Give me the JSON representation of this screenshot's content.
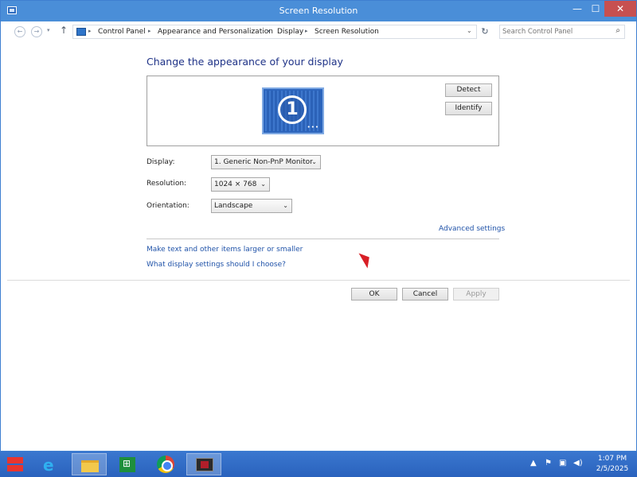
{
  "window": {
    "title": "Screen Resolution",
    "controls": {
      "minimize": "—",
      "maximize": "☐",
      "close": "✕"
    }
  },
  "navigation": {
    "back": "←",
    "forward": "→",
    "recent": "▾",
    "up": "↑",
    "breadcrumbs": [
      "Control Panel",
      "Appearance and Personalization",
      "Display",
      "Screen Resolution"
    ],
    "separator": "▸",
    "dropdown": "⌄",
    "refresh": "↻",
    "search_placeholder": "Search Control Panel",
    "search_icon": "⌕"
  },
  "main": {
    "heading": "Change the appearance of your display",
    "monitor": {
      "number": "1",
      "dots": "•••"
    },
    "detect_label": "Detect",
    "identify_label": "Identify",
    "display_label": "Display:",
    "display_value": "1. Generic Non-PnP Monitor",
    "resolution_label": "Resolution:",
    "resolution_value": "1024 × 768",
    "orientation_label": "Orientation:",
    "orientation_value": "Landscape",
    "select_arrow": "⌄",
    "advanced_link": "Advanced settings",
    "text_size_link": "Make text and other items larger or smaller",
    "help_link": "What display settings should I choose?"
  },
  "dialog_buttons": {
    "ok": "OK",
    "cancel": "Cancel",
    "apply": "Apply",
    "apply_enabled": false
  },
  "taskbar": {
    "apps": [
      "start",
      "internet-explorer",
      "file-explorer",
      "store",
      "chrome",
      "screen-resolution"
    ],
    "tray_icons": {
      "show_hidden": "▲",
      "flag": "⚑",
      "network": "▣",
      "volume": "◀)"
    },
    "time": "1:07 PM",
    "date": "2/5/2025"
  },
  "colors": {
    "titlebar": "#4a8ed8",
    "taskbar": "#2a62bd",
    "link": "#1f52a8",
    "heading": "#1e3287",
    "close": "#c75050"
  }
}
